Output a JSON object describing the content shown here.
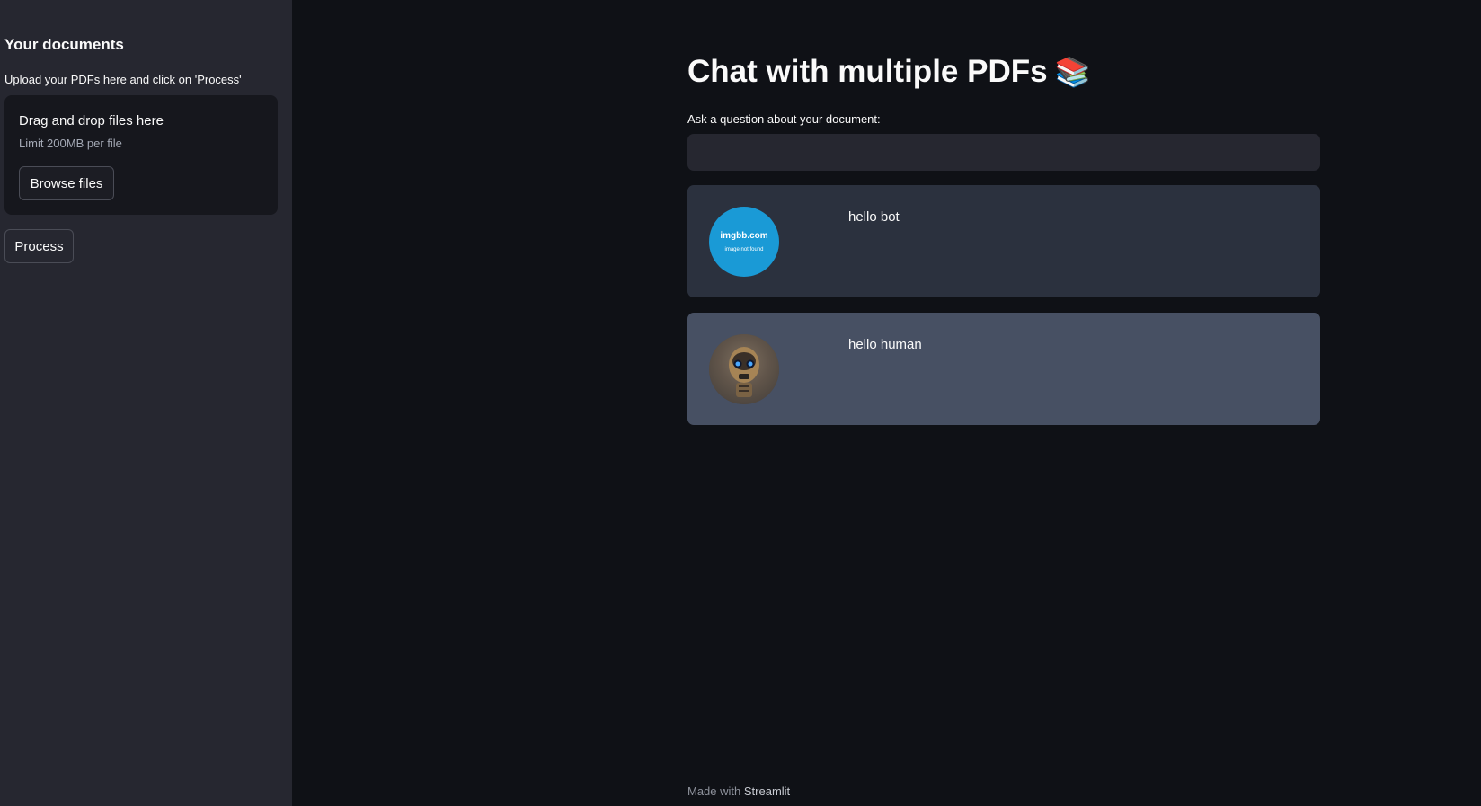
{
  "sidebar": {
    "title": "Your documents",
    "caption": "Upload your PDFs here and click on 'Process'",
    "dropzone": {
      "title": "Drag and drop files here",
      "limit": "Limit 200MB per file",
      "browse_label": "Browse files"
    },
    "process_label": "Process"
  },
  "main": {
    "title": "Chat with multiple PDFs",
    "title_icon": "📚",
    "input_label": "Ask a question about your document:",
    "input_value": "",
    "messages": [
      {
        "text": "hello bot",
        "avatar": {
          "brand": "imgbb.com",
          "note": "image not found"
        },
        "background": "#2b313e"
      },
      {
        "text": "hello human",
        "avatar": {
          "icon": "robot-avatar-icon"
        },
        "background": "#475063"
      }
    ]
  },
  "footer": {
    "prefix": "Made with",
    "link": "Streamlit"
  },
  "colors": {
    "app_bg": "#0f1116",
    "sidebar_bg": "#262730",
    "imgbb_blue": "#1a9ad6"
  }
}
